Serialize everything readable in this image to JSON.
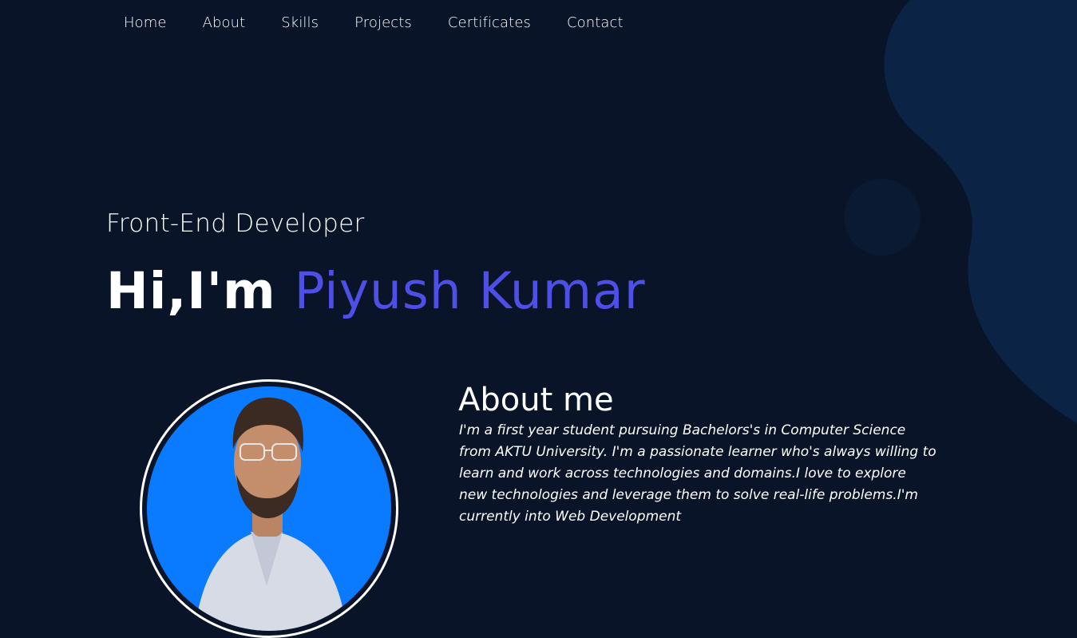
{
  "nav": {
    "items": [
      {
        "label": "Home"
      },
      {
        "label": "About"
      },
      {
        "label": "Skills"
      },
      {
        "label": "Projects"
      },
      {
        "label": "Certificates"
      },
      {
        "label": "Contact"
      }
    ]
  },
  "hero": {
    "role": "Front-End Developer",
    "greeting": "Hi,I'm",
    "name": "Piyush Kumar"
  },
  "about": {
    "title": "About me",
    "text": "I'm a first year student pursuing Bachelors's in Computer Science from AKTU University. I'm a passionate learner who's always willing to learn and work across technologies and domains.I love to explore new technologies and leverage them to solve real-life problems.I'm currently into Web Development"
  },
  "colors": {
    "background": "#091428",
    "accent": "#4e4fe6",
    "avatar_bg": "#0a7bff"
  }
}
